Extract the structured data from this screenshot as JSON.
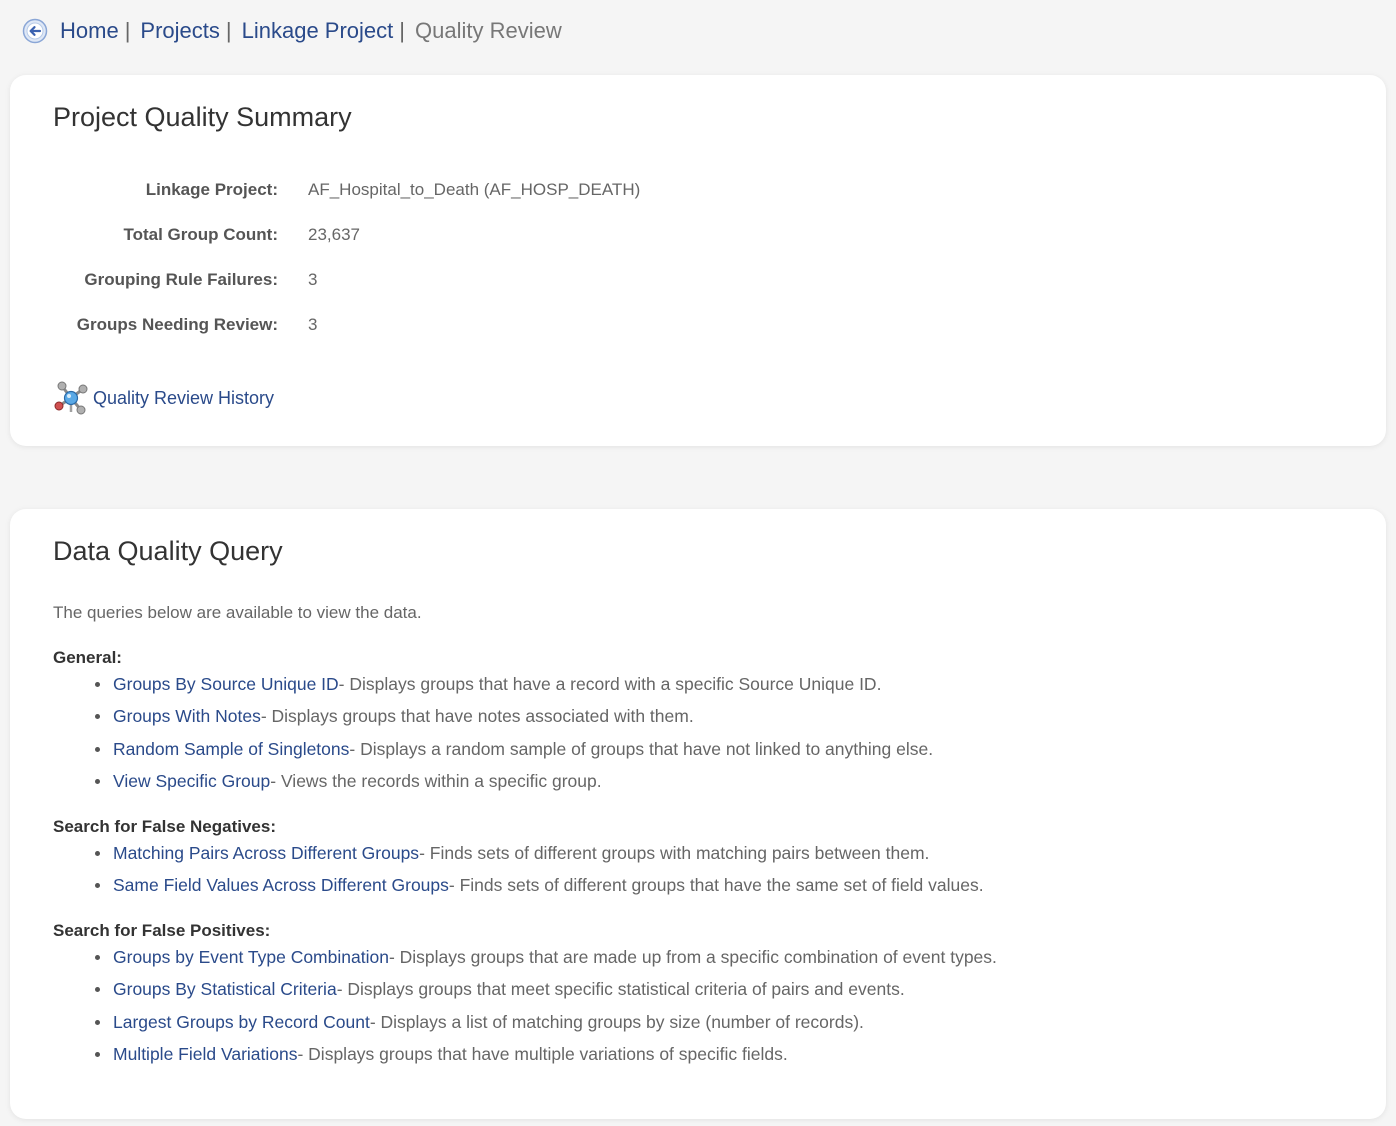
{
  "breadcrumb": {
    "items": [
      {
        "label": "Home",
        "sep": "|"
      },
      {
        "label": "Projects",
        "sep": "|"
      },
      {
        "label": "Linkage Project",
        "sep": "|"
      }
    ],
    "current": "Quality Review"
  },
  "summary": {
    "title": "Project Quality Summary",
    "rows": [
      {
        "label": "Linkage Project:",
        "value": "AF_Hospital_to_Death (AF_HOSP_DEATH)"
      },
      {
        "label": "Total Group Count:",
        "value": "23,637"
      },
      {
        "label": "Grouping Rule Failures:",
        "value": "3"
      },
      {
        "label": "Groups Needing Review:",
        "value": "3"
      }
    ],
    "history_link": "Quality Review History"
  },
  "query": {
    "title": "Data Quality Query",
    "intro": "The queries below are available to view the data.",
    "sections": [
      {
        "heading": "General:",
        "items": [
          {
            "link": "Groups By Source Unique ID",
            "desc": " - Displays groups that have a record with a specific Source Unique ID."
          },
          {
            "link": "Groups With Notes",
            "desc": " - Displays groups that have notes associated with them."
          },
          {
            "link": "Random Sample of Singletons",
            "desc": " - Displays a random sample of groups that have not linked to anything else."
          },
          {
            "link": "View Specific Group",
            "desc": " - Views the records within a specific group."
          }
        ]
      },
      {
        "heading": "Search for False Negatives:",
        "items": [
          {
            "link": "Matching Pairs Across Different Groups",
            "desc": " - Finds sets of different groups with matching pairs between them."
          },
          {
            "link": "Same Field Values Across Different Groups",
            "desc": " - Finds sets of different groups that have the same set of field values."
          }
        ]
      },
      {
        "heading": "Search for False Positives:",
        "items": [
          {
            "link": "Groups by Event Type Combination",
            "desc": " - Displays groups that are made up from a specific combination of event types."
          },
          {
            "link": "Groups By Statistical Criteria",
            "desc": " - Displays groups that meet specific statistical criteria of pairs and events."
          },
          {
            "link": "Largest Groups by Record Count",
            "desc": " - Displays a list of matching groups by size (number of records)."
          },
          {
            "link": "Multiple Field Variations",
            "desc": " - Displays groups that have multiple variations of specific fields."
          }
        ]
      }
    ]
  },
  "colors": {
    "link": "#2a4a8a",
    "text": "#666666",
    "heading": "#333333"
  }
}
